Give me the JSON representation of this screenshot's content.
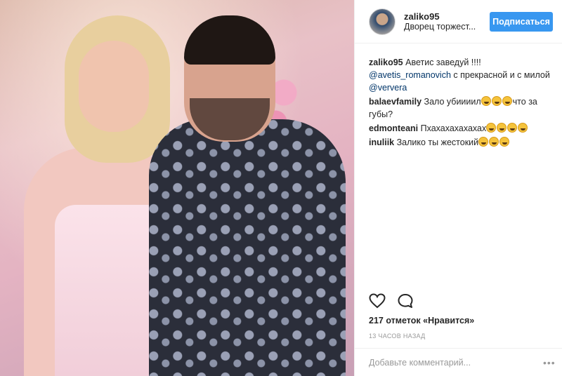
{
  "post": {
    "photo_alt": "",
    "header": {
      "username": "zaliko95",
      "location": "Дворец торжест...",
      "follow_label": "Подписаться"
    },
    "caption": {
      "user": "zaliko95",
      "text_1": "Аветис заведуй !!!!",
      "mention_1": "@avetis_romanovich",
      "text_2": " с прекрасной и с милой ",
      "mention_2": "@ververa"
    },
    "comments": [
      {
        "user": "balaevfamily",
        "text_before": "Зало убиииил",
        "emoji_count": 3,
        "text_after": "что за губы?"
      },
      {
        "user": "edmonteani",
        "text_before": "Пхахахахахахах",
        "emoji_count": 4,
        "text_after": ""
      },
      {
        "user": "inuliik",
        "text_before": "Залико ты жестокий",
        "emoji_count": 3,
        "text_after": ""
      }
    ],
    "likes_text": "217 отметок «Нравится»",
    "time_text": "13 часов назад",
    "add_comment_placeholder": "Добавьте комментарий...",
    "more_icon": "•••"
  },
  "colors": {
    "accent": "#3897f0",
    "mention": "#003569",
    "muted": "#999999"
  },
  "icons": [
    "heart-icon",
    "comment-icon",
    "more-options-icon",
    "laughing-emoji-icon"
  ]
}
